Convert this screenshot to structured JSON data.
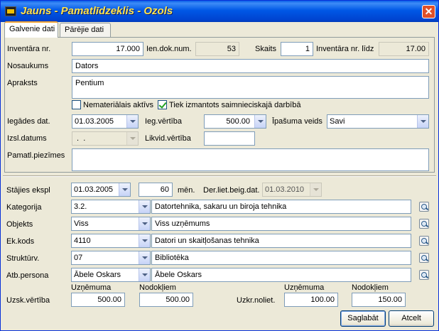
{
  "window": {
    "title": "Jauns - Pamatlīdzeklis - Ozols",
    "close": "✕"
  },
  "tabs": [
    {
      "label": "Galvenie dati",
      "active": true
    },
    {
      "label": "Pārējie dati",
      "active": false
    }
  ],
  "main": {
    "inventara_nr": {
      "label": "Inventāra nr.",
      "value": "17.000"
    },
    "ien_dok_num": {
      "label": "Ien.dok.num.",
      "value": "53"
    },
    "skaits": {
      "label": "Skaits",
      "value": "1"
    },
    "inventara_nr_lidz": {
      "label": "Inventāra nr. līdz",
      "value": "17.00"
    },
    "nosaukums": {
      "label": "Nosaukums",
      "value": "Dators"
    },
    "apraksts": {
      "label": "Apraksts",
      "value": "Pentium"
    },
    "nematerialais": {
      "label": "Nemateriālais aktīvs",
      "checked": false
    },
    "saimnieciska": {
      "label": "Tiek izmantots saimnieciskajā darbībā",
      "checked": true
    },
    "iegades_dat": {
      "label": "Iegādes dat.",
      "value": "01.03.2005"
    },
    "ieg_vertiba": {
      "label": "Ieg.vērtība",
      "value": "500.00"
    },
    "ipasuma_veids": {
      "label": "Īpašuma veids",
      "value": "Savi"
    },
    "izsl_datums": {
      "label": "Izsl.datums",
      "value": " .  ."
    },
    "likvid_vertiba": {
      "label": "Likvid.vērtība",
      "value": ""
    },
    "pamatl_piezimes": {
      "label": "Pamatl.piezīmes",
      "value": ""
    }
  },
  "lower": {
    "stajies_ekspl": {
      "label": "Stājies ekspl",
      "value": "01.03.2005"
    },
    "men": {
      "value": "60",
      "unit": "mēn."
    },
    "der_liet": {
      "label": "Der.liet.beig.dat.",
      "value": "01.03.2010"
    },
    "rows": [
      {
        "label": "Kategorija",
        "code": "3.2.",
        "desc": "Datortehnika, sakaru un biroja tehnika"
      },
      {
        "label": "Objekts",
        "code": "Viss",
        "desc": "Viss uzņēmums"
      },
      {
        "label": "Ek.kods",
        "code": "4110",
        "desc": "Datori un skaitļošanas tehnika"
      },
      {
        "label": "Struktūrv.",
        "code": "07",
        "desc": "Bibliotēka"
      },
      {
        "label": "Atb.persona",
        "code": "Ābele Oskars",
        "desc": "Ābele Oskars"
      }
    ],
    "head_uznemuma_1": "Uzņēmuma",
    "head_nodokljiem_1": "Nodokļiem",
    "head_uznemuma_2": "Uzņēmuma",
    "head_nodokljiem_2": "Nodokļiem",
    "uzsk_vertiba": {
      "label": "Uzsk.vērtība",
      "uznemuma": "500.00",
      "nodokljiem": "500.00"
    },
    "uzkr_noliet": {
      "label": "Uzkr.noliet.",
      "uznemuma": "100.00",
      "nodokljiem": "150.00"
    }
  },
  "buttons": {
    "save": "Saglabāt",
    "cancel": "Atcelt"
  }
}
